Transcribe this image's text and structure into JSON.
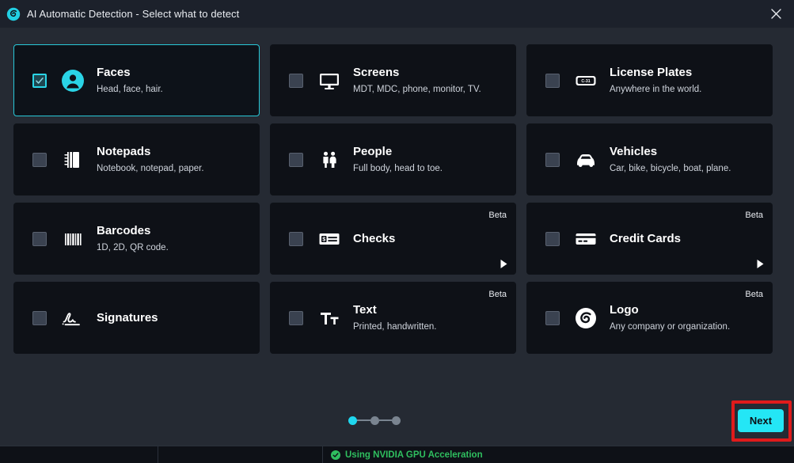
{
  "window": {
    "title": "AI Automatic Detection - Select what to detect",
    "logo_icon": "spiral-logo-icon",
    "close_icon": "close-icon"
  },
  "accent_color": "#2ad4e6",
  "highlight_color": "#e01b1b",
  "cards": [
    {
      "id": "faces",
      "title": "Faces",
      "desc": "Head, face, hair.",
      "icon": "person-circle-icon",
      "checked": true,
      "beta": "",
      "has_arrow": false
    },
    {
      "id": "screens",
      "title": "Screens",
      "desc": "MDT, MDC, phone, monitor, TV.",
      "icon": "monitor-icon",
      "checked": false,
      "beta": "",
      "has_arrow": false
    },
    {
      "id": "license-plates",
      "title": "License Plates",
      "desc": "Anywhere in the world.",
      "icon": "license-plate-icon",
      "checked": false,
      "beta": "",
      "has_arrow": false
    },
    {
      "id": "notepads",
      "title": "Notepads",
      "desc": "Notebook, notepad, paper.",
      "icon": "notepad-icon",
      "checked": false,
      "beta": "",
      "has_arrow": false
    },
    {
      "id": "people",
      "title": "People",
      "desc": "Full body, head to toe.",
      "icon": "people-icon",
      "checked": false,
      "beta": "",
      "has_arrow": false
    },
    {
      "id": "vehicles",
      "title": "Vehicles",
      "desc": "Car, bike, bicycle, boat, plane.",
      "icon": "car-icon",
      "checked": false,
      "beta": "",
      "has_arrow": false
    },
    {
      "id": "barcodes",
      "title": "Barcodes",
      "desc": "1D, 2D, QR code.",
      "icon": "barcode-icon",
      "checked": false,
      "beta": "",
      "has_arrow": false
    },
    {
      "id": "checks",
      "title": "Checks",
      "desc": "",
      "icon": "check-document-icon",
      "checked": false,
      "beta": "Beta",
      "has_arrow": true
    },
    {
      "id": "credit-cards",
      "title": "Credit Cards",
      "desc": "",
      "icon": "credit-card-icon",
      "checked": false,
      "beta": "Beta",
      "has_arrow": true
    },
    {
      "id": "signatures",
      "title": "Signatures",
      "desc": "",
      "icon": "signature-icon",
      "checked": false,
      "beta": "",
      "has_arrow": false
    },
    {
      "id": "text",
      "title": "Text",
      "desc": "Printed, handwritten.",
      "icon": "text-size-icon",
      "checked": false,
      "beta": "Beta",
      "has_arrow": false
    },
    {
      "id": "logo",
      "title": "Logo",
      "desc": "Any company or organization.",
      "icon": "spiral-logo-icon",
      "checked": false,
      "beta": "Beta",
      "has_arrow": false
    }
  ],
  "footer": {
    "steps": {
      "total": 3,
      "active_index": 0
    },
    "next_label": "Next"
  },
  "statusbar": {
    "cell1": "",
    "cell2": "",
    "gpu_icon": "check-circle-icon",
    "gpu_text": "Using NVIDIA GPU Acceleration"
  }
}
